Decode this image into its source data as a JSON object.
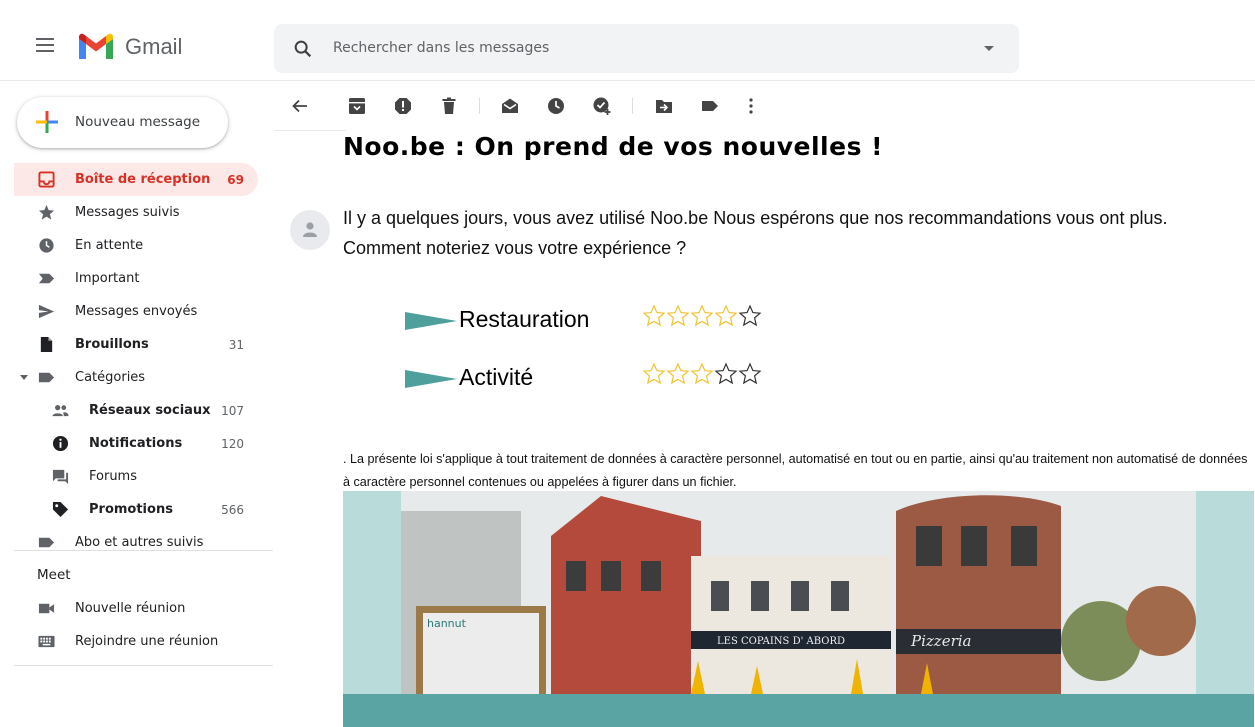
{
  "app": {
    "name": "Gmail"
  },
  "search": {
    "placeholder": "Rechercher dans les messages"
  },
  "compose": {
    "label": "Nouveau message"
  },
  "sidebar": {
    "items": [
      {
        "label": "Boîte de réception",
        "count": "69",
        "icon": "inbox-icon"
      },
      {
        "label": "Messages suivis",
        "count": "",
        "icon": "star-icon"
      },
      {
        "label": "En attente",
        "count": "",
        "icon": "clock-icon"
      },
      {
        "label": "Important",
        "count": "",
        "icon": "important-icon"
      },
      {
        "label": "Messages envoyés",
        "count": "",
        "icon": "send-icon"
      },
      {
        "label": "Brouillons",
        "count": "31",
        "icon": "draft-icon"
      },
      {
        "label": "Catégories",
        "count": "",
        "icon": "label-icon"
      },
      {
        "label": "Réseaux sociaux",
        "count": "107",
        "icon": "people-icon"
      },
      {
        "label": "Notifications",
        "count": "120",
        "icon": "info-icon"
      },
      {
        "label": "Forums",
        "count": "",
        "icon": "forum-icon"
      },
      {
        "label": "Promotions",
        "count": "566",
        "icon": "tag-icon"
      },
      {
        "label": "Abo et autres suivis",
        "count": "",
        "icon": "label-icon"
      }
    ]
  },
  "meet": {
    "title": "Meet",
    "items": [
      {
        "label": "Nouvelle réunion",
        "icon": "video-icon"
      },
      {
        "label": "Rejoindre une réunion",
        "icon": "keyboard-icon"
      }
    ]
  },
  "message": {
    "subject": "Noo.be : On prend de vos nouvelles !",
    "intro": "Il y a quelques jours, vous avez utilisé Noo.be Nous espérons que nos recommandations vous ont plus. Comment noteriez vous votre expérience ?",
    "ratings": [
      {
        "label": "Restauration",
        "stars_max": 5,
        "stars_filled": 4
      },
      {
        "label": "Activité",
        "stars_max": 5,
        "stars_filled": 3
      }
    ],
    "legal": ". La présente loi s'applique à tout traitement de données à caractère personnel, automatisé en tout ou en partie, ainsi qu'au traitement non automatisé de données à caractère personnel contenues ou appelées à figurer dans un fichier.",
    "photo_signs": {
      "hannut": "hannut",
      "copains": "LES COPAINS D' ABORD",
      "pizzeria": "Pizzeria"
    }
  },
  "colors": {
    "gmail_red": "#d93025",
    "active_bg": "#fce8e6",
    "teal": "#5aa5a3",
    "teal_light": "#b9dbd9",
    "star_gold": "#f2c230"
  }
}
